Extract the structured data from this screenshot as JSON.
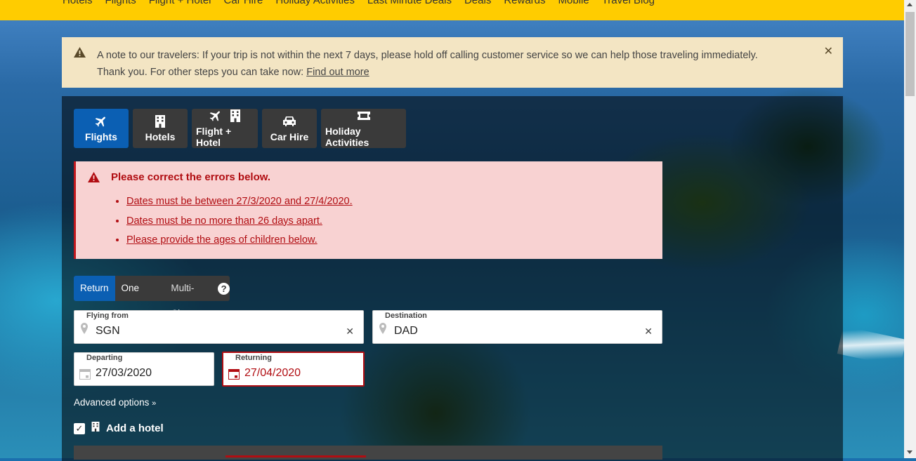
{
  "top_nav": {
    "links": [
      "Hotels",
      "Flights",
      "Flight + Hotel",
      "Car Hire",
      "Holiday Activities",
      "Last Minute Deals",
      "Deals",
      "Rewards",
      "Mobile",
      "Travel Blog"
    ]
  },
  "notice": {
    "line1": "A note to our travelers: If your trip is not within the next 7 days, please hold off calling customer service so we can help those traveling immediately.",
    "line2": "Thank you. For other steps you can take now: ",
    "link": "Find out more",
    "close_icon": "close-icon"
  },
  "tabs": [
    {
      "label": "Flights",
      "icons": [
        "plane-icon"
      ],
      "active": true
    },
    {
      "label": "Hotels",
      "icons": [
        "building-icon"
      ],
      "active": false
    },
    {
      "label": "Flight + Hotel",
      "icons": [
        "plane-icon",
        "building-icon"
      ],
      "active": false
    },
    {
      "label": "Car Hire",
      "icons": [
        "car-icon"
      ],
      "active": false
    },
    {
      "label": "Holiday Activities",
      "icons": [
        "ticket-icon"
      ],
      "active": false
    }
  ],
  "error": {
    "title": "Please correct the errors below.",
    "items": [
      "Dates must be between 27/3/2020 and 27/4/2020.",
      "Dates must be no more than 26 days apart.",
      "Please provide the ages of children below."
    ]
  },
  "trip_type": {
    "options": [
      "Return",
      "One way",
      "Multi-City"
    ],
    "selected": "Return",
    "help": "?"
  },
  "fields": {
    "from": {
      "label": "Flying from",
      "value": "SGN"
    },
    "destination": {
      "label": "Destination",
      "value": "DAD"
    },
    "departing": {
      "label": "Departing",
      "value": "27/03/2020"
    },
    "returning": {
      "label": "Returning",
      "value": "27/04/2020"
    }
  },
  "advanced_options": "Advanced options",
  "add_hotel": {
    "label": "Add a hotel",
    "checked": true
  },
  "colors": {
    "nav_yellow": "#ffcc00",
    "active_blue": "#0b5fb3",
    "error_red": "#b10d12",
    "error_bg": "#f8d2d2",
    "notice_bg": "#f3e5c3"
  }
}
